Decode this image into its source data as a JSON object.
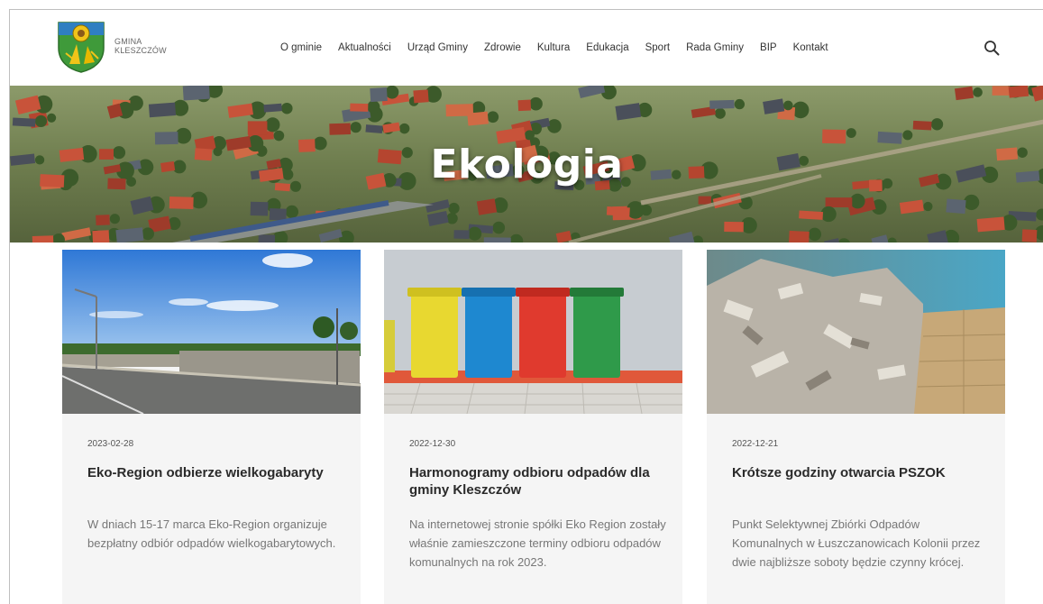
{
  "brand": {
    "line1": "GMINA",
    "line2": "KLESZCZÓW"
  },
  "nav": [
    "O gminie",
    "Aktualności",
    "Urząd Gminy",
    "Zdrowie",
    "Kultura",
    "Edukacja",
    "Sport",
    "Rada Gminy",
    "BIP",
    "Kontakt"
  ],
  "hero": {
    "title": "Ekologia"
  },
  "cards": [
    {
      "date": "2023-02-28",
      "title": "Eko-Region odbierze wielkogabaryty",
      "text": "W dniach 15-17 marca Eko-Region organizuje bezpłatny odbiór odpadów wielkogabarytowych."
    },
    {
      "date": "2022-12-30",
      "title": "Harmonogramy odbioru odpadów dla gminy Kleszczów",
      "text": "Na internetowej stronie spółki Eko Region zostały właśnie zamieszczone terminy odbioru odpadów komunalnych na rok 2023."
    },
    {
      "date": "2022-12-21",
      "title": "Krótsze godziny otwarcia PSZOK",
      "text": "Punkt Selektywnej Zbiórki Odpadów Komunalnych w Łuszczanowicach Kolonii przez dwie najbliższe soboty będzie czynny krócej."
    }
  ],
  "colors": {
    "bin_yellow": "#e8d830",
    "bin_blue": "#1e88d0",
    "bin_red": "#e03a2e",
    "bin_green": "#2f9a4a"
  },
  "icons": {
    "search": "search-icon",
    "logo": "coat-of-arms-logo"
  }
}
